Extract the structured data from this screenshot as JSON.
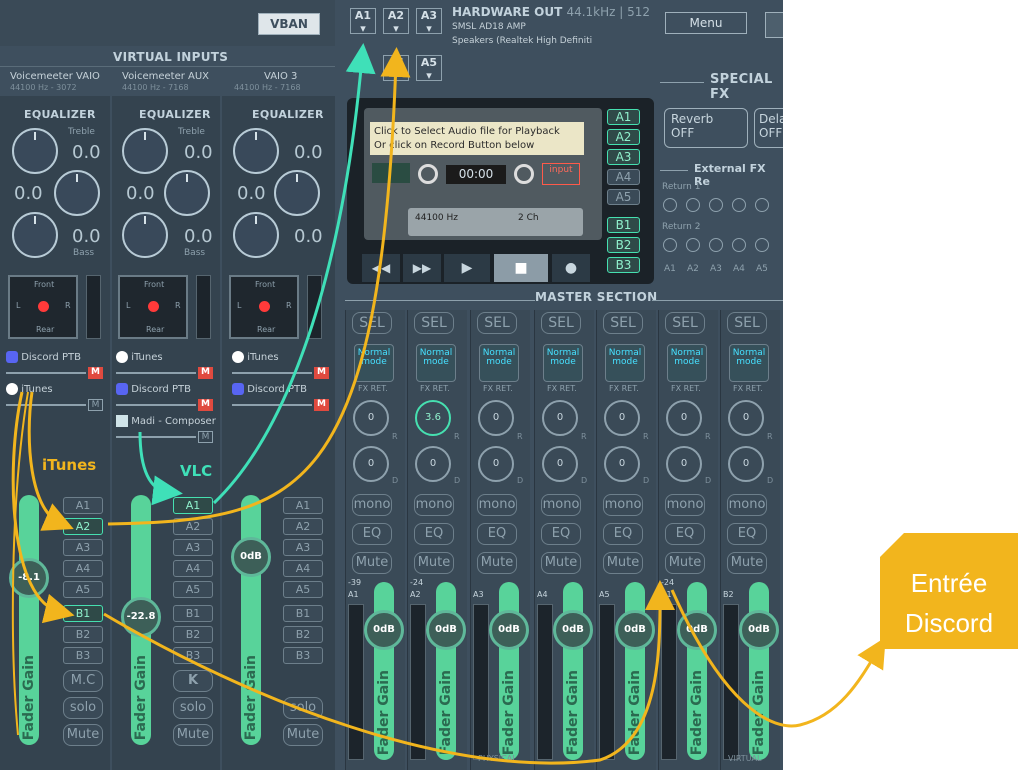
{
  "vban_label": "VBAN",
  "menu_label": "Menu",
  "hw": {
    "title": "HARDWARE OUT",
    "rate": "44.1kHz | 512",
    "dev1": "SMSL AD18 AMP",
    "dev2": "Speakers (Realtek High Definiti",
    "buttons": [
      "A1",
      "A2",
      "A3",
      "A4",
      "A5"
    ]
  },
  "virtual_inputs_title": "VIRTUAL INPUTS",
  "strips": [
    {
      "name": "Voicemeeter VAIO",
      "rate": "44100 Hz - 3072",
      "eq": "EQUALIZER",
      "treble_label": "Treble",
      "bass_label": "Bass",
      "treble": "0.0",
      "mid": "0.0",
      "bass": "0.0",
      "apps": [
        "Discord PTB",
        "iTunes"
      ],
      "fader_value": "-8.1",
      "fader_label": "Fader Gain"
    },
    {
      "name": "Voicemeeter AUX",
      "rate": "44100 Hz - 7168",
      "eq": "EQUALIZER",
      "treble_label": "Treble",
      "bass_label": "Bass",
      "treble": "0.0",
      "mid": "0.0",
      "bass": "0.0",
      "apps": [
        "iTunes",
        "Discord PTB",
        "Madi - Composer"
      ],
      "fader_value": "-22.8",
      "fader_label": "Fader Gain"
    },
    {
      "name": "VAIO 3",
      "rate": "44100 Hz - 7168",
      "eq": "EQUALIZER",
      "treble_label": "Treble",
      "bass_label": "Bass",
      "treble": "0.0",
      "mid": "0.0",
      "bass": "0.0",
      "apps": [
        "iTunes",
        "Discord PTB"
      ],
      "fader_value": "0dB",
      "fader_label": "Fader Gain"
    }
  ],
  "pan": {
    "front": "Front",
    "rear": "Rear",
    "l": "L",
    "r": "R"
  },
  "bus_buttons": [
    "A1",
    "A2",
    "A3",
    "A4",
    "A5",
    "B1",
    "B2",
    "B3"
  ],
  "strip_extra": {
    "mc": "M.C",
    "k": "K",
    "solo": "solo",
    "mute": "Mute",
    "m": "M"
  },
  "recorder": {
    "line1": "Click to Select Audio file for Playback",
    "line2": "Or click on Record Button below",
    "time": "00:00",
    "input": "input",
    "hz": "44100 Hz",
    "ch": "2 Ch",
    "route": [
      "A1",
      "A2",
      "A3",
      "A4",
      "A5",
      "B1",
      "B2",
      "B3"
    ]
  },
  "special_fx": {
    "title": "SPECIAL FX",
    "reverb": "Reverb",
    "reverb_state": "OFF",
    "delay": "Dela",
    "delay_state": "OFF",
    "ext_title": "External FX Re",
    "return1": "Return 1",
    "return2": "Return 2",
    "cols": [
      "A1",
      "A2",
      "A3",
      "A4",
      "A5"
    ]
  },
  "master": {
    "title": "MASTER SECTION",
    "sel": "SEL",
    "mode": "Normal mode",
    "fxret": "FX RET.",
    "mono": "mono",
    "eq": "EQ",
    "mute": "Mute",
    "physical": "PHYSICAL",
    "virtual": "VIRTUAL",
    "buses": [
      {
        "label": "A1",
        "level": "-39",
        "knob1": "0",
        "knob2": "0",
        "gain": "0dB"
      },
      {
        "label": "A2",
        "level": "-24",
        "knob1": "3.6",
        "knob2": "0",
        "gain": "0dB"
      },
      {
        "label": "A3",
        "level": "",
        "knob1": "0",
        "knob2": "0",
        "gain": "0dB"
      },
      {
        "label": "A4",
        "level": "",
        "knob1": "0",
        "knob2": "0",
        "gain": "0dB"
      },
      {
        "label": "A5",
        "level": "",
        "knob1": "0",
        "knob2": "0",
        "gain": "0dB"
      },
      {
        "label": "B1",
        "level": "-24",
        "knob1": "0",
        "knob2": "0",
        "gain": "0dB"
      },
      {
        "label": "B2",
        "level": "",
        "knob1": "0",
        "knob2": "0",
        "gain": "0dB"
      }
    ],
    "fader_label": "Fader Gain",
    "r": "R",
    "d": "D"
  },
  "annotations": {
    "itunes": "iTunes",
    "vlc": "VLC",
    "discord_line1": "Entrée",
    "discord_line2": "Discord"
  },
  "colors": {
    "teal": "#3fe0b8",
    "gold": "#f2b51d",
    "bg": "#3e4f5e"
  }
}
